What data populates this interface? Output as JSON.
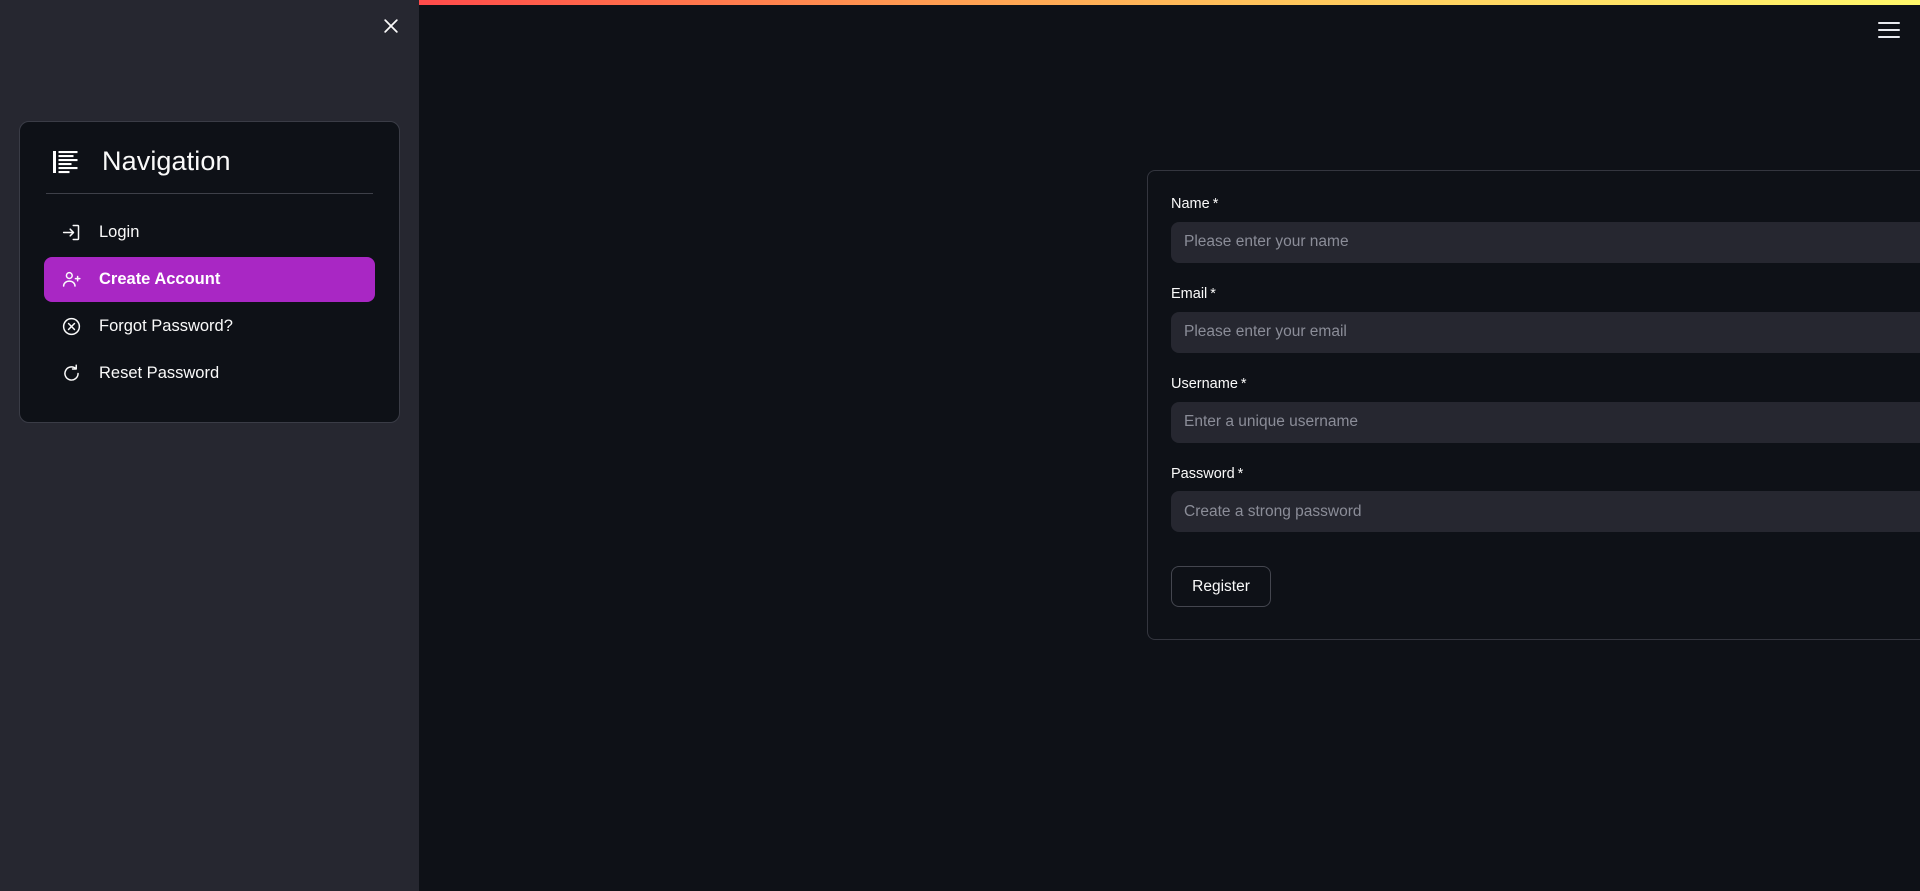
{
  "topbar": {
    "accent_gradient_from": "#ff4b4b",
    "accent_gradient_to": "#fff86b",
    "menu_icon": "hamburger-menu-icon"
  },
  "drawer": {
    "close_icon": "close-icon",
    "nav": {
      "icon": "list-lines-icon",
      "title": "Navigation",
      "active_color": "#a927c4",
      "items": [
        {
          "label": "Login",
          "icon": "login-arrow-icon",
          "active": false
        },
        {
          "label": "Create Account",
          "icon": "user-plus-icon",
          "active": true
        },
        {
          "label": "Forgot Password?",
          "icon": "x-circle-icon",
          "active": false
        },
        {
          "label": "Reset Password",
          "icon": "reset-rotate-icon",
          "active": false
        }
      ]
    }
  },
  "form": {
    "fields": [
      {
        "label": "Name",
        "required_mark": "*",
        "placeholder": "Please enter your name",
        "value": ""
      },
      {
        "label": "Email",
        "required_mark": "*",
        "placeholder": "Please enter your email",
        "value": ""
      },
      {
        "label": "Username",
        "required_mark": "*",
        "placeholder": "Enter a unique username",
        "value": ""
      },
      {
        "label": "Password",
        "required_mark": "*",
        "placeholder": "Create a strong password",
        "value": "",
        "reveal_icon": "eye-icon"
      }
    ],
    "submit_label": "Register"
  }
}
